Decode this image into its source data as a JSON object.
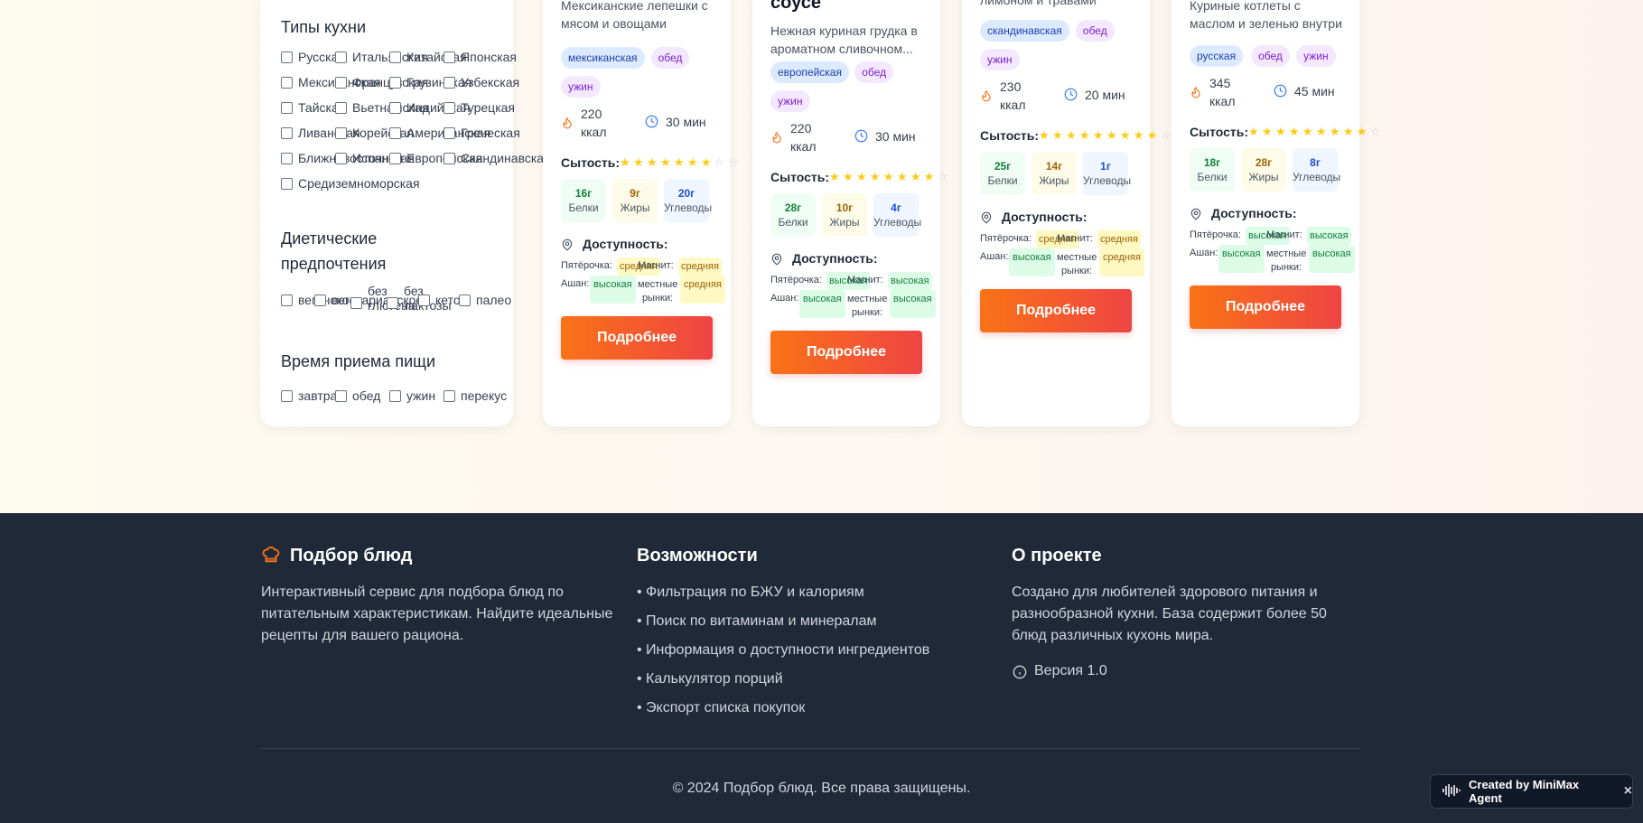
{
  "filters": {
    "cuisine_title": "Типы кухни",
    "cuisines": [
      "Русская",
      "Итальянская",
      "Китайская",
      "Японская",
      "Мексиканская",
      "Французская",
      "Грузинская",
      "Узбекская",
      "Тайская",
      "Вьетнамская",
      "Индийская",
      "Турецкая",
      "Ливанская",
      "Корейская",
      "Американская",
      "Греческая",
      "Ближневосточная",
      "Испанская",
      "Европейская",
      "Скандинавская",
      "Средиземноморская"
    ],
    "diet_title": "Диетические предпочтения",
    "diets": [
      "веганское",
      "вегетарианское",
      "без глютена",
      "без лактозы",
      "кето",
      "палео"
    ],
    "meal_title": "Время приема пищи",
    "meals": [
      "завтрак",
      "обед",
      "ужин",
      "перекус"
    ]
  },
  "cards": [
    {
      "title": "",
      "desc": "Мексиканские лепешки с мясом и овощами",
      "tags": [
        "мексиканская",
        "обед",
        "ужин"
      ],
      "kcal": "220 ккал",
      "time": "30 мин",
      "satiety_label": "Сытость:",
      "satiety": 7,
      "protein": "16г",
      "fat": "9г",
      "carbs": "20г",
      "avail_title": "Доступность:",
      "stores": {
        "pyat": "Пятёрочка:",
        "pyat_lvl": "средняя",
        "magnit": "Магнит:",
        "magnit_lvl": "средняя",
        "ashan": "Ашан:",
        "ashan_lvl": "высокая",
        "local": "местные рынки:",
        "local_lvl": "средняя"
      },
      "button": "Подробнее"
    },
    {
      "title": "соусе",
      "desc": "Нежная куриная грудка в ароматном сливочном...",
      "tags": [
        "европейская",
        "обед",
        "ужин"
      ],
      "kcal": "220 ккал",
      "time": "30 мин",
      "satiety_label": "Сытость:",
      "satiety": 8,
      "protein": "28г",
      "fat": "10г",
      "carbs": "4г",
      "avail_title": "Доступность:",
      "stores": {
        "pyat": "Пятёрочка:",
        "pyat_lvl": "высокая",
        "magnit": "Магнит:",
        "magnit_lvl": "высокая",
        "ashan": "Ашан:",
        "ashan_lvl": "высокая",
        "local": "местные рынки:",
        "local_lvl": "высокая"
      },
      "button": "Подробнее"
    },
    {
      "title": "",
      "desc": "лимоном и травами",
      "tags": [
        "скандинавская",
        "обед",
        "ужин"
      ],
      "kcal": "230 ккал",
      "time": "20 мин",
      "satiety_label": "Сытость:",
      "satiety": 9,
      "protein": "25г",
      "fat": "14г",
      "carbs": "1г",
      "avail_title": "Доступность:",
      "stores": {
        "pyat": "Пятёрочка:",
        "pyat_lvl": "средняя",
        "magnit": "Магнит:",
        "magnit_lvl": "средняя",
        "ashan": "Ашан:",
        "ashan_lvl": "высокая",
        "local": "местные рынки:",
        "local_lvl": "средняя"
      },
      "button": "Подробнее"
    },
    {
      "title": "",
      "desc": "Куриные котлеты с маслом и зеленью внутри",
      "tags": [
        "русская",
        "обед",
        "ужин"
      ],
      "kcal": "345 ккал",
      "time": "45 мин",
      "satiety_label": "Сытость:",
      "satiety": 9,
      "protein": "18г",
      "fat": "28г",
      "carbs": "8г",
      "avail_title": "Доступность:",
      "stores": {
        "pyat": "Пятёрочка:",
        "pyat_lvl": "высокая",
        "magnit": "Магнит:",
        "magnit_lvl": "высокая",
        "ashan": "Ашан:",
        "ashan_lvl": "высокая",
        "local": "местные рынки:",
        "local_lvl": "высокая"
      },
      "button": "Подробнее"
    }
  ],
  "macro_labels": {
    "protein": "Белки",
    "fat": "Жиры",
    "carbs": "Углеводы"
  },
  "footer": {
    "brand": "Подбор блюд",
    "brand_text": "Интерактивный сервис для подбора блюд по питательным характеристикам. Найдите идеальные рецепты для вашего рациона.",
    "features_title": "Возможности",
    "features": [
      "• Фильтрация по БЖУ и калориям",
      "• Поиск по витаминам и минералам",
      "• Информация о доступности ингредиентов",
      "• Калькулятор порций",
      "• Экспорт списка покупок"
    ],
    "about_title": "О проекте",
    "about_text": "Создано для любителей здорового питания и разнообразной кухни. База содержит более 50 блюд различных кухонь мира.",
    "version": "Версия 1.0",
    "copyright": "© 2024 Подбор блюд. Все права защищены."
  },
  "badge": {
    "label": "Created by MiniMax Agent",
    "close": "×"
  },
  "colors": {
    "accent_start": "#f97316",
    "accent_end": "#ef4444",
    "footer_bg": "#1f2937"
  }
}
